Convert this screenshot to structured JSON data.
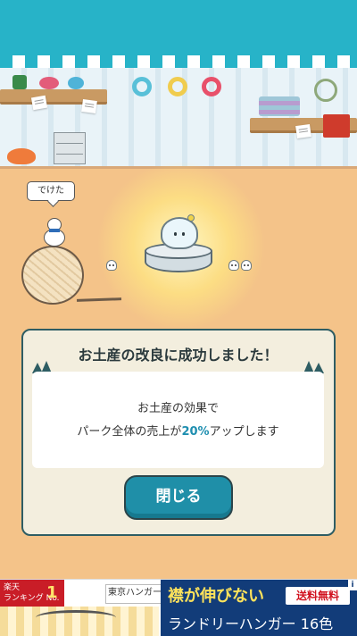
{
  "speech": {
    "text": "でけた"
  },
  "dialog": {
    "title": "お土産の改良に成功しました！",
    "line1": "お土産の効果で",
    "line2_before": "パーク全体の売上が",
    "line2_highlight": "20%",
    "line2_after": "アップします",
    "close_label": "閉じる"
  },
  "ad": {
    "rank_label": "楽天\nランキング No.",
    "rank_number": "1",
    "brand": "東京ハンガー",
    "headline": "襟が伸びない",
    "free_shipping": "送料無料",
    "product": "ランドリーハンガー 16色",
    "info_icon_label": "i"
  },
  "colors": {
    "awning": "#27b3c8",
    "floor": "#f4c389",
    "dialog_border": "#2e5d63",
    "button": "#1f8fa8",
    "highlight": "#1f8fb0"
  },
  "icons": [
    "yarn-roll-icon",
    "scissors-icon",
    "pin-cushion-icon",
    "towel-icon",
    "tree-icon",
    "info-icon"
  ]
}
